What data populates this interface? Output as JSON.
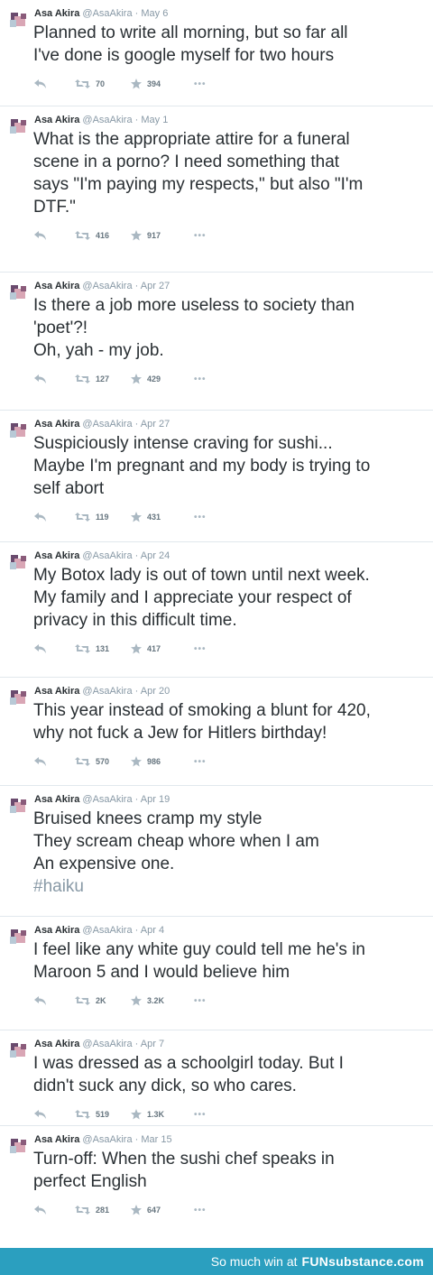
{
  "tweets": [
    {
      "name": "Asa Akira",
      "handle": "@AsaAkira",
      "sep": "·",
      "date": "May 6",
      "lines": [
        "Planned to write all morning, but so far all",
        "I've done is google myself for two hours"
      ],
      "retweets": "70",
      "favorites": "394"
    },
    {
      "name": "Asa Akira",
      "handle": "@AsaAkira",
      "sep": "·",
      "date": "May 1",
      "lines": [
        "What is the appropriate attire for a funeral",
        "scene in a porno? I need something that",
        "says \"I'm paying my respects,\" but also \"I'm",
        "DTF.\""
      ],
      "retweets": "416",
      "favorites": "917"
    },
    {
      "name": "Asa Akira",
      "handle": "@AsaAkira",
      "sep": "·",
      "date": "Apr 27",
      "lines": [
        "Is there a job more useless to society than",
        "'poet'?!",
        "Oh, yah - my job."
      ],
      "retweets": "127",
      "favorites": "429"
    },
    {
      "name": "Asa Akira",
      "handle": "@AsaAkira",
      "sep": "·",
      "date": "Apr 27",
      "lines": [
        "Suspiciously intense craving for sushi...",
        "Maybe I'm pregnant and my body is trying to",
        "self abort"
      ],
      "retweets": "119",
      "favorites": "431"
    },
    {
      "name": "Asa Akira",
      "handle": "@AsaAkira",
      "sep": "·",
      "date": "Apr 24",
      "lines": [
        "My Botox lady is out of town until next week.",
        "My family and I appreciate your respect of",
        "privacy in this difficult time."
      ],
      "retweets": "131",
      "favorites": "417"
    },
    {
      "name": "Asa Akira",
      "handle": "@AsaAkira",
      "sep": "·",
      "date": "Apr 20",
      "lines": [
        "This year instead of smoking a blunt for 420,",
        "why not fuck a Jew for Hitlers birthday!"
      ],
      "retweets": "570",
      "favorites": "986"
    },
    {
      "name": "Asa Akira",
      "handle": "@AsaAkira",
      "sep": "·",
      "date": "Apr 19",
      "lines": [
        "Bruised knees cramp my style",
        "They scream cheap whore when I am",
        "An expensive one.",
        "#haiku"
      ],
      "hashtag_line": 3
    },
    {
      "name": "Asa Akira",
      "handle": "@AsaAkira",
      "sep": "·",
      "date": "Apr 4",
      "lines": [
        "I feel like any white guy could tell me he's in",
        "Maroon 5 and I would believe him"
      ],
      "retweets": "2K",
      "favorites": "3.2K"
    },
    {
      "name": "Asa Akira",
      "handle": "@AsaAkira",
      "sep": "·",
      "date": "Apr 7",
      "lines": [
        "I was dressed as a schoolgirl today. But I",
        "didn't suck any dick, so who cares."
      ],
      "retweets": "519",
      "favorites": "1.3K"
    },
    {
      "name": "Asa Akira",
      "handle": "@AsaAkira",
      "sep": "·",
      "date": "Mar 15",
      "lines": [
        "Turn-off: When the sushi chef speaks in",
        "perfect English"
      ],
      "retweets": "281",
      "favorites": "647"
    }
  ],
  "icons": {
    "reply": "reply-icon",
    "retweet": "retweet-icon",
    "favorite": "star-icon",
    "more": "more-dots-icon"
  },
  "more_label": "•••",
  "footer": {
    "text": "So much win at",
    "brand": "FUNsubstance.com"
  },
  "colors": {
    "footer_bg": "#2b9fbf",
    "muted": "#8899a6",
    "text": "#292f33",
    "divider": "#e1e8ed"
  }
}
